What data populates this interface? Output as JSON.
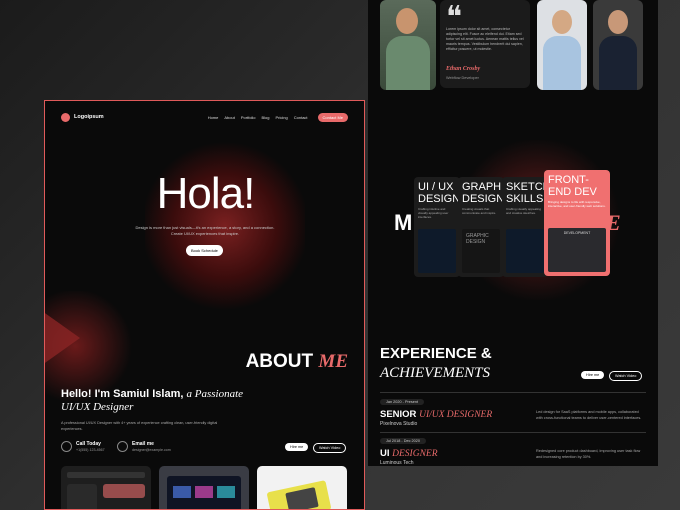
{
  "left": {
    "logo": "Logoipsum",
    "nav": [
      "Home",
      "About",
      "Portfolio",
      "Blog",
      "Pricing",
      "Contact"
    ],
    "nav_cta": "Contact Me",
    "hero_title": "Hola!",
    "hero_sub": "Design is more than just visuals—it's an experience, a story, and a connection. Create UI/UX experiences that inspire.",
    "hero_button": "Book Schedule",
    "about_a": "ABOUT",
    "about_b": "ME",
    "intro_a": "Hello! I'm Samiul Islam,",
    "intro_b": "a Passionate",
    "intro_c": "UI/UX Designer",
    "intro_text": "A professional UI/UX Designer with 4+ years of experience crafting clean, user-friendly digital experiences.",
    "call_title": "Call Today",
    "call_value": "+1(555) 123-4567",
    "email_title": "Email me",
    "email_value": "designer@example.com",
    "hire_button": "Hire me",
    "video_button": "Watch Video"
  },
  "right": {
    "quote_text": "Lorem ipsum dolor sit amet, consectetur adipiscing elit. Fusce ac eleifend dui. Etiam sed tortor vel sit amet luctus. Aenean mattis tellus vel mauris tempus. Vestibulum hendrerit dui sapien, efficitur posuere, ut molestie.",
    "quote_name": "Ethan Crosby",
    "quote_role": "Webflow Developer",
    "m_letter": "M",
    "e_letter": "E",
    "skills": [
      {
        "title": "UI / UX DESIGN",
        "desc": "Crafting intuitive and visually appealing user interfaces."
      },
      {
        "title": "GRAPHIC DESIGN",
        "desc": "Creating visuals that communicate and inspire."
      },
      {
        "title": "SKETCH SKILLS",
        "desc": "Crafting visually appealing and creative sketches."
      },
      {
        "title": "FRONT-END DEV",
        "desc": "Bringing designs to life with responsive, interactive, and user-friendly web solutions.",
        "img_label": "DEVELOPMENT"
      }
    ],
    "graphic_label": "GRAPHIC DESIGN",
    "exp_a": "EXPERIENCE &",
    "exp_b": "ACHIEVEMENTS",
    "hire_button": "Hire me",
    "video_button": "Watch Video",
    "jobs": [
      {
        "date": "Jan 2020 - Present",
        "role_a": "SENIOR",
        "role_b": "UI/UX DESIGNER",
        "company": "Pixelnova Studio",
        "desc": "Led design for SaaS platforms and mobile apps, collaborated with cross-functional teams to deliver user-centered interfaces."
      },
      {
        "date": "Jul 2018 - Dec 2020",
        "role_a": "UI",
        "role_b": "DESIGNER",
        "company": "Luminous Tech",
        "desc": "Redesigned core product dashboard, improving user task flow and increasing retention by 30%."
      }
    ]
  },
  "colors": {
    "accent": "#e86a6a",
    "bg": "#0a0a0a"
  }
}
